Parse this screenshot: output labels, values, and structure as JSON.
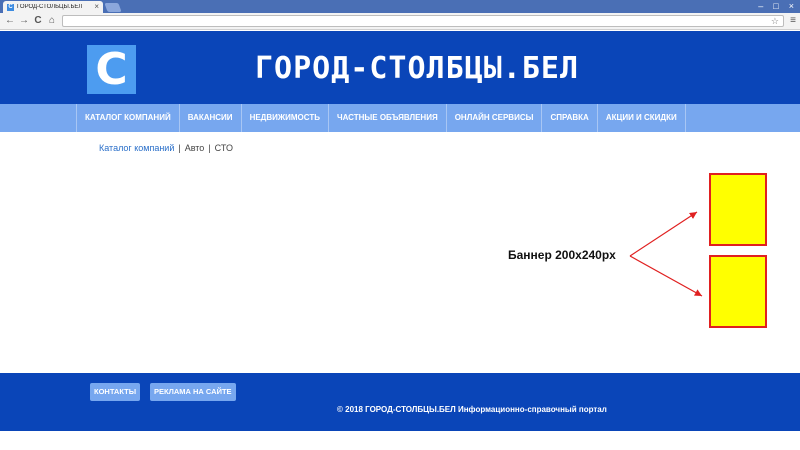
{
  "browser": {
    "tab_title": "ГОРОД-СТОЛБЦЫ.БЕЛ",
    "favicon_letter": "C",
    "tab_close": "×",
    "win_minimize": "–",
    "win_maximize": "□",
    "win_close": "×",
    "back": "←",
    "forward": "→",
    "reload": "C",
    "home": "⌂",
    "address": "",
    "star": "☆",
    "menu": "≡"
  },
  "header": {
    "logo_letter": "C",
    "title": "ГОРОД-СТОЛБЦЫ.БЕЛ"
  },
  "nav": {
    "items": [
      {
        "label": "КАТАЛОГ КОМПАНИЙ"
      },
      {
        "label": "ВАКАНСИИ"
      },
      {
        "label": "НЕДВИЖИМОСТЬ"
      },
      {
        "label": "ЧАСТНЫЕ ОБЪЯВЛЕНИЯ"
      },
      {
        "label": "ОНЛАЙН СЕРВИСЫ"
      },
      {
        "label": "СПРАВКА"
      },
      {
        "label": "АКЦИИ И СКИДКИ"
      }
    ]
  },
  "breadcrumb": {
    "items": [
      "Каталог компаний",
      "Авто",
      "СТО"
    ],
    "separator": "|"
  },
  "banner": {
    "label": "Баннер 200х240px",
    "fill_color": "#ffff00",
    "border_color": "#e02020"
  },
  "footer": {
    "buttons": [
      "КОНТАКТЫ",
      "РЕКЛАМА НА САЙТЕ"
    ],
    "copyright": "© 2018  ГОРОД-СТОЛБЦЫ.БЕЛ  Информационно-справочный портал"
  },
  "colors": {
    "brand_blue": "#0a45b8",
    "nav_blue": "#77a7ef",
    "logo_blue": "#4d9cf0"
  }
}
